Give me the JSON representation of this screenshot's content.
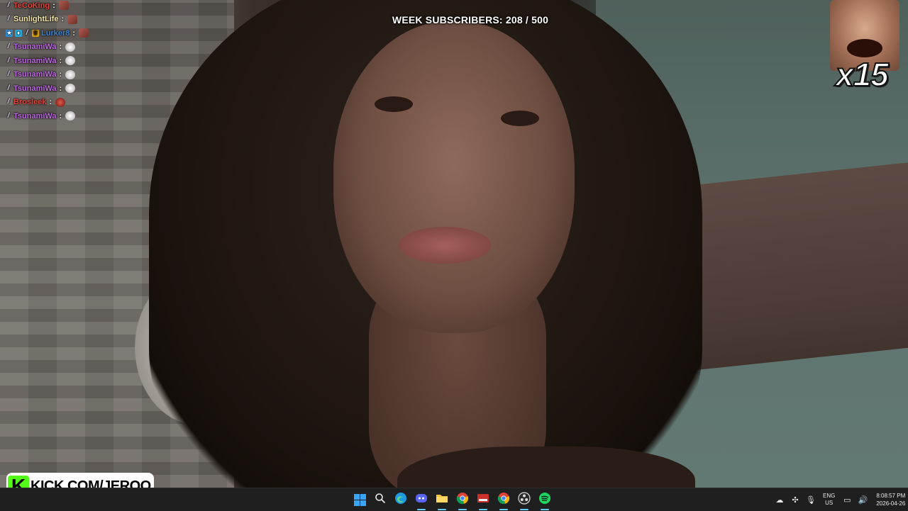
{
  "overlay": {
    "subscribers": "WEEK SUBSCRIBERS: 208 / 500",
    "combo_count": "x15",
    "watermark": "KICK.COM/JERQO",
    "watermark_logo": "K"
  },
  "chat": [
    {
      "user": "TeCoKing",
      "color": "#e0443a",
      "badges": [
        "pencil"
      ],
      "emote": "red"
    },
    {
      "user": "SunlightLife",
      "color": "#f3e6a8",
      "badges": [
        "pencil"
      ],
      "emote": "red"
    },
    {
      "user": "Lurker8",
      "color": "#3a86d9",
      "badges": [
        "sub",
        "gift",
        "pencil",
        "crown"
      ],
      "emote": "red"
    },
    {
      "user": "TsunamiWa",
      "color": "#c067e6",
      "badges": [
        "pencil"
      ],
      "emote": "white"
    },
    {
      "user": "TsunamiWa",
      "color": "#c067e6",
      "badges": [
        "pencil"
      ],
      "emote": "white"
    },
    {
      "user": "TsunamiWa",
      "color": "#c067e6",
      "badges": [
        "pencil"
      ],
      "emote": "white"
    },
    {
      "user": "TsunamiWa",
      "color": "#c067e6",
      "badges": [
        "pencil"
      ],
      "emote": "white"
    },
    {
      "user": "Brosleek",
      "color": "#e0443a",
      "badges": [
        "pencil"
      ],
      "emote": "redface"
    },
    {
      "user": "TsunamiWa",
      "color": "#c067e6",
      "badges": [
        "pencil"
      ],
      "emote": "white"
    }
  ],
  "taskbar": {
    "apps": [
      {
        "name": "start-button",
        "icon": "windows-logo",
        "active": false
      },
      {
        "name": "search-button",
        "icon": "search-icon",
        "active": false
      },
      {
        "name": "edge-app",
        "icon": "edge-icon",
        "active": false
      },
      {
        "name": "discord-app",
        "icon": "discord-icon",
        "active": true
      },
      {
        "name": "file-explorer-app",
        "icon": "folder-icon",
        "active": true
      },
      {
        "name": "chrome-app",
        "icon": "chrome-icon",
        "active": true
      },
      {
        "name": "stream-app",
        "icon": "stream-tool-icon",
        "active": true
      },
      {
        "name": "chrome-profile-app",
        "icon": "chrome-icon",
        "active": true
      },
      {
        "name": "obs-app",
        "icon": "obs-icon",
        "active": true
      },
      {
        "name": "spotify-app",
        "icon": "spotify-icon",
        "active": true
      }
    ],
    "tray": {
      "lang_top": "ENG",
      "lang_bottom": "US",
      "time": "8:08:57 PM",
      "date": "2026-04-26"
    }
  }
}
